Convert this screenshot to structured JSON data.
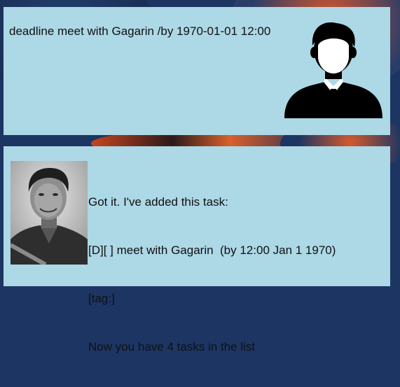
{
  "window": {
    "background_color": "#1c3563",
    "bubble_color": "#add8e6"
  },
  "messages": {
    "user": {
      "text": "deadline meet with Gagarin /by 1970-01-01 12:00",
      "avatar": "user-silhouette-icon"
    },
    "duke": {
      "line1": "Got it. I've added this task:",
      "line2": "[D][ ] meet with Gagarin  (by 12:00 Jan 1 1970)",
      "line3": "[tag:]",
      "line4": "Now you have 4 tasks in the list",
      "avatar": "gagarin-portrait"
    }
  }
}
